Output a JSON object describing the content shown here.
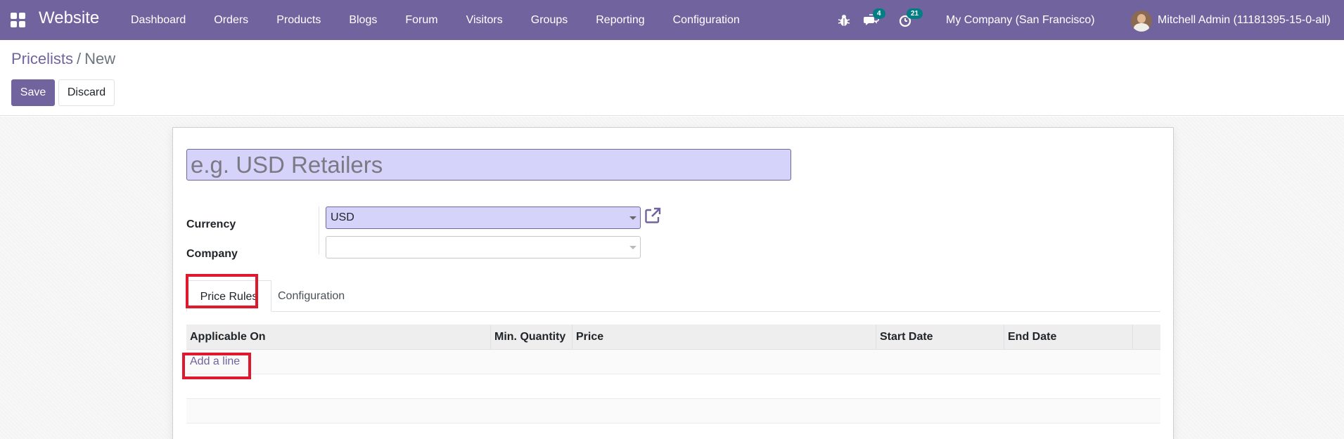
{
  "navbar": {
    "app_name": "Website",
    "menu": [
      "Dashboard",
      "Orders",
      "Products",
      "Blogs",
      "Forum",
      "Visitors",
      "Groups",
      "Reporting",
      "Configuration"
    ],
    "messages_count": "4",
    "activities_count": "21",
    "company": "My Company (San Francisco)",
    "user": "Mitchell Admin (11181395-15-0-all)"
  },
  "breadcrumb": {
    "parent": "Pricelists",
    "separator": "/",
    "current": "New"
  },
  "buttons": {
    "save": "Save",
    "discard": "Discard"
  },
  "form": {
    "name_placeholder": "e.g. USD Retailers",
    "currency_label": "Currency",
    "currency_value": "USD",
    "company_label": "Company",
    "company_value": ""
  },
  "tabs": {
    "price_rules": "Price Rules",
    "configuration": "Configuration"
  },
  "table": {
    "columns": [
      "Applicable On",
      "Min. Quantity",
      "Price",
      "Start Date",
      "End Date"
    ],
    "add_line": "Add a line"
  },
  "colors": {
    "brand": "#71639e",
    "badge": "#017e84",
    "highlight": "#e0182d",
    "field_fill": "#d5d3f9"
  }
}
